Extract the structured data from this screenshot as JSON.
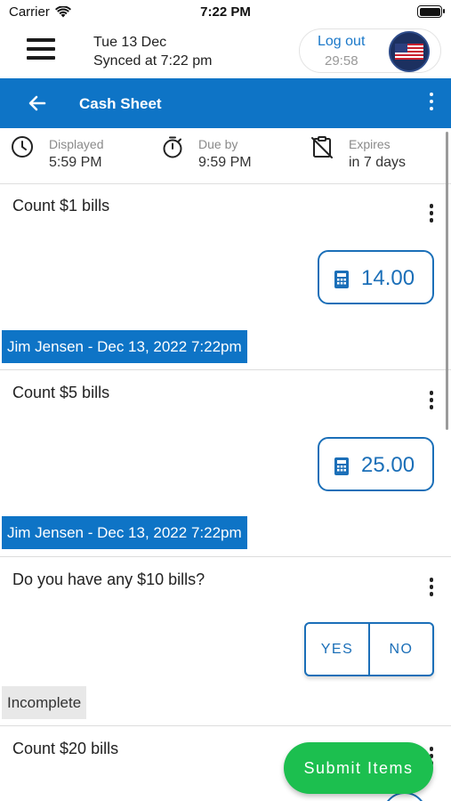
{
  "status_bar": {
    "carrier": "Carrier",
    "time": "7:22 PM"
  },
  "header": {
    "date": "Tue 13 Dec",
    "synced": "Synced at 7:22 pm",
    "logout_label": "Log out",
    "logout_timer": "29:58",
    "avatar_icon": "us-flag-avatar"
  },
  "titlebar": {
    "title": "Cash Sheet",
    "color": "#0e74c6"
  },
  "info": {
    "displayed_label": "Displayed",
    "displayed_value": "5:59 PM",
    "due_label": "Due by",
    "due_value": "9:59 PM",
    "expires_label": "Expires",
    "expires_value": "in 7 days"
  },
  "items": [
    {
      "title": "Count $1 bills",
      "value": "14.00",
      "stamp": "Jim Jensen - Dec 13, 2022 7:22pm"
    },
    {
      "title": "Count $5 bills",
      "value": "25.00",
      "stamp": "Jim Jensen - Dec 13, 2022 7:22pm"
    },
    {
      "title": "Do you have any $10 bills?",
      "yes_label": "YES",
      "no_label": "NO",
      "status": "Incomplete"
    },
    {
      "title": "Count $20 bills"
    }
  ],
  "submit_label": "Submit Items",
  "colors": {
    "accent": "#1b6fb8",
    "submit": "#1cbf4f"
  }
}
